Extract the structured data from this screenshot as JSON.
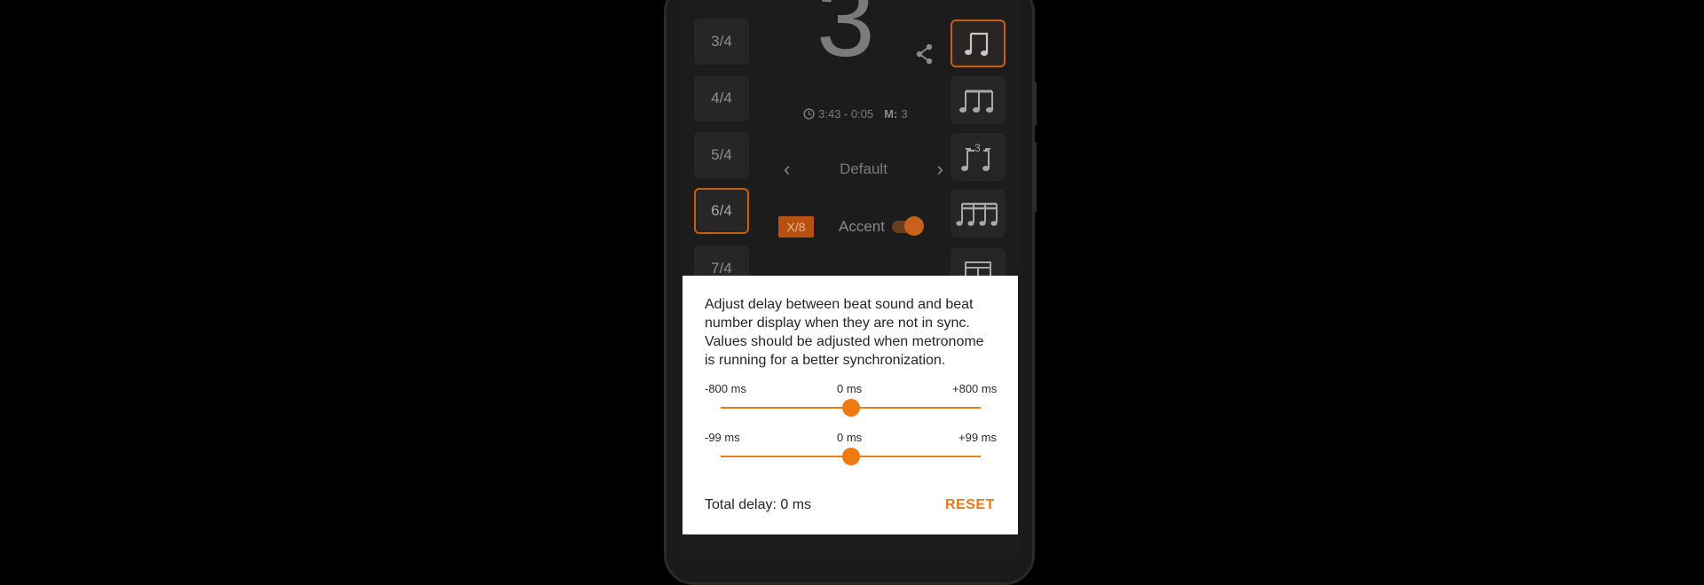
{
  "time_signatures": [
    "3/4",
    "4/4",
    "5/4",
    "6/4",
    "7/4"
  ],
  "selected_time_signature": "6/4",
  "beat_display": "3",
  "timer": {
    "time": "3:43 - 0:05",
    "measure_label": "M:",
    "measure_value": "3"
  },
  "preset": {
    "name": "Default"
  },
  "x8_label": "X/8",
  "accent": {
    "label": "Accent",
    "on": true
  },
  "note_types": [
    "quarter-note-icon",
    "eighth-notes-icon",
    "triplet-icon",
    "sixteenth-notes-icon",
    "custom-pattern-icon"
  ],
  "colors": {
    "accent": "#f07a12",
    "selected_border": "#c65e14"
  },
  "dialog": {
    "message": "Adjust delay between beat sound and beat number display when they are not in sync. Values should be adjusted when metronome is running for a better synchronization.",
    "slider1": {
      "min_label": "-800 ms",
      "value_label": "0 ms",
      "max_label": "+800 ms",
      "min": -800,
      "max": 800,
      "value": 0
    },
    "slider2": {
      "min_label": "-99 ms",
      "value_label": "0 ms",
      "max_label": "+99 ms",
      "min": -99,
      "max": 99,
      "value": 0
    },
    "total": "Total delay: 0 ms",
    "reset": "RESET"
  }
}
